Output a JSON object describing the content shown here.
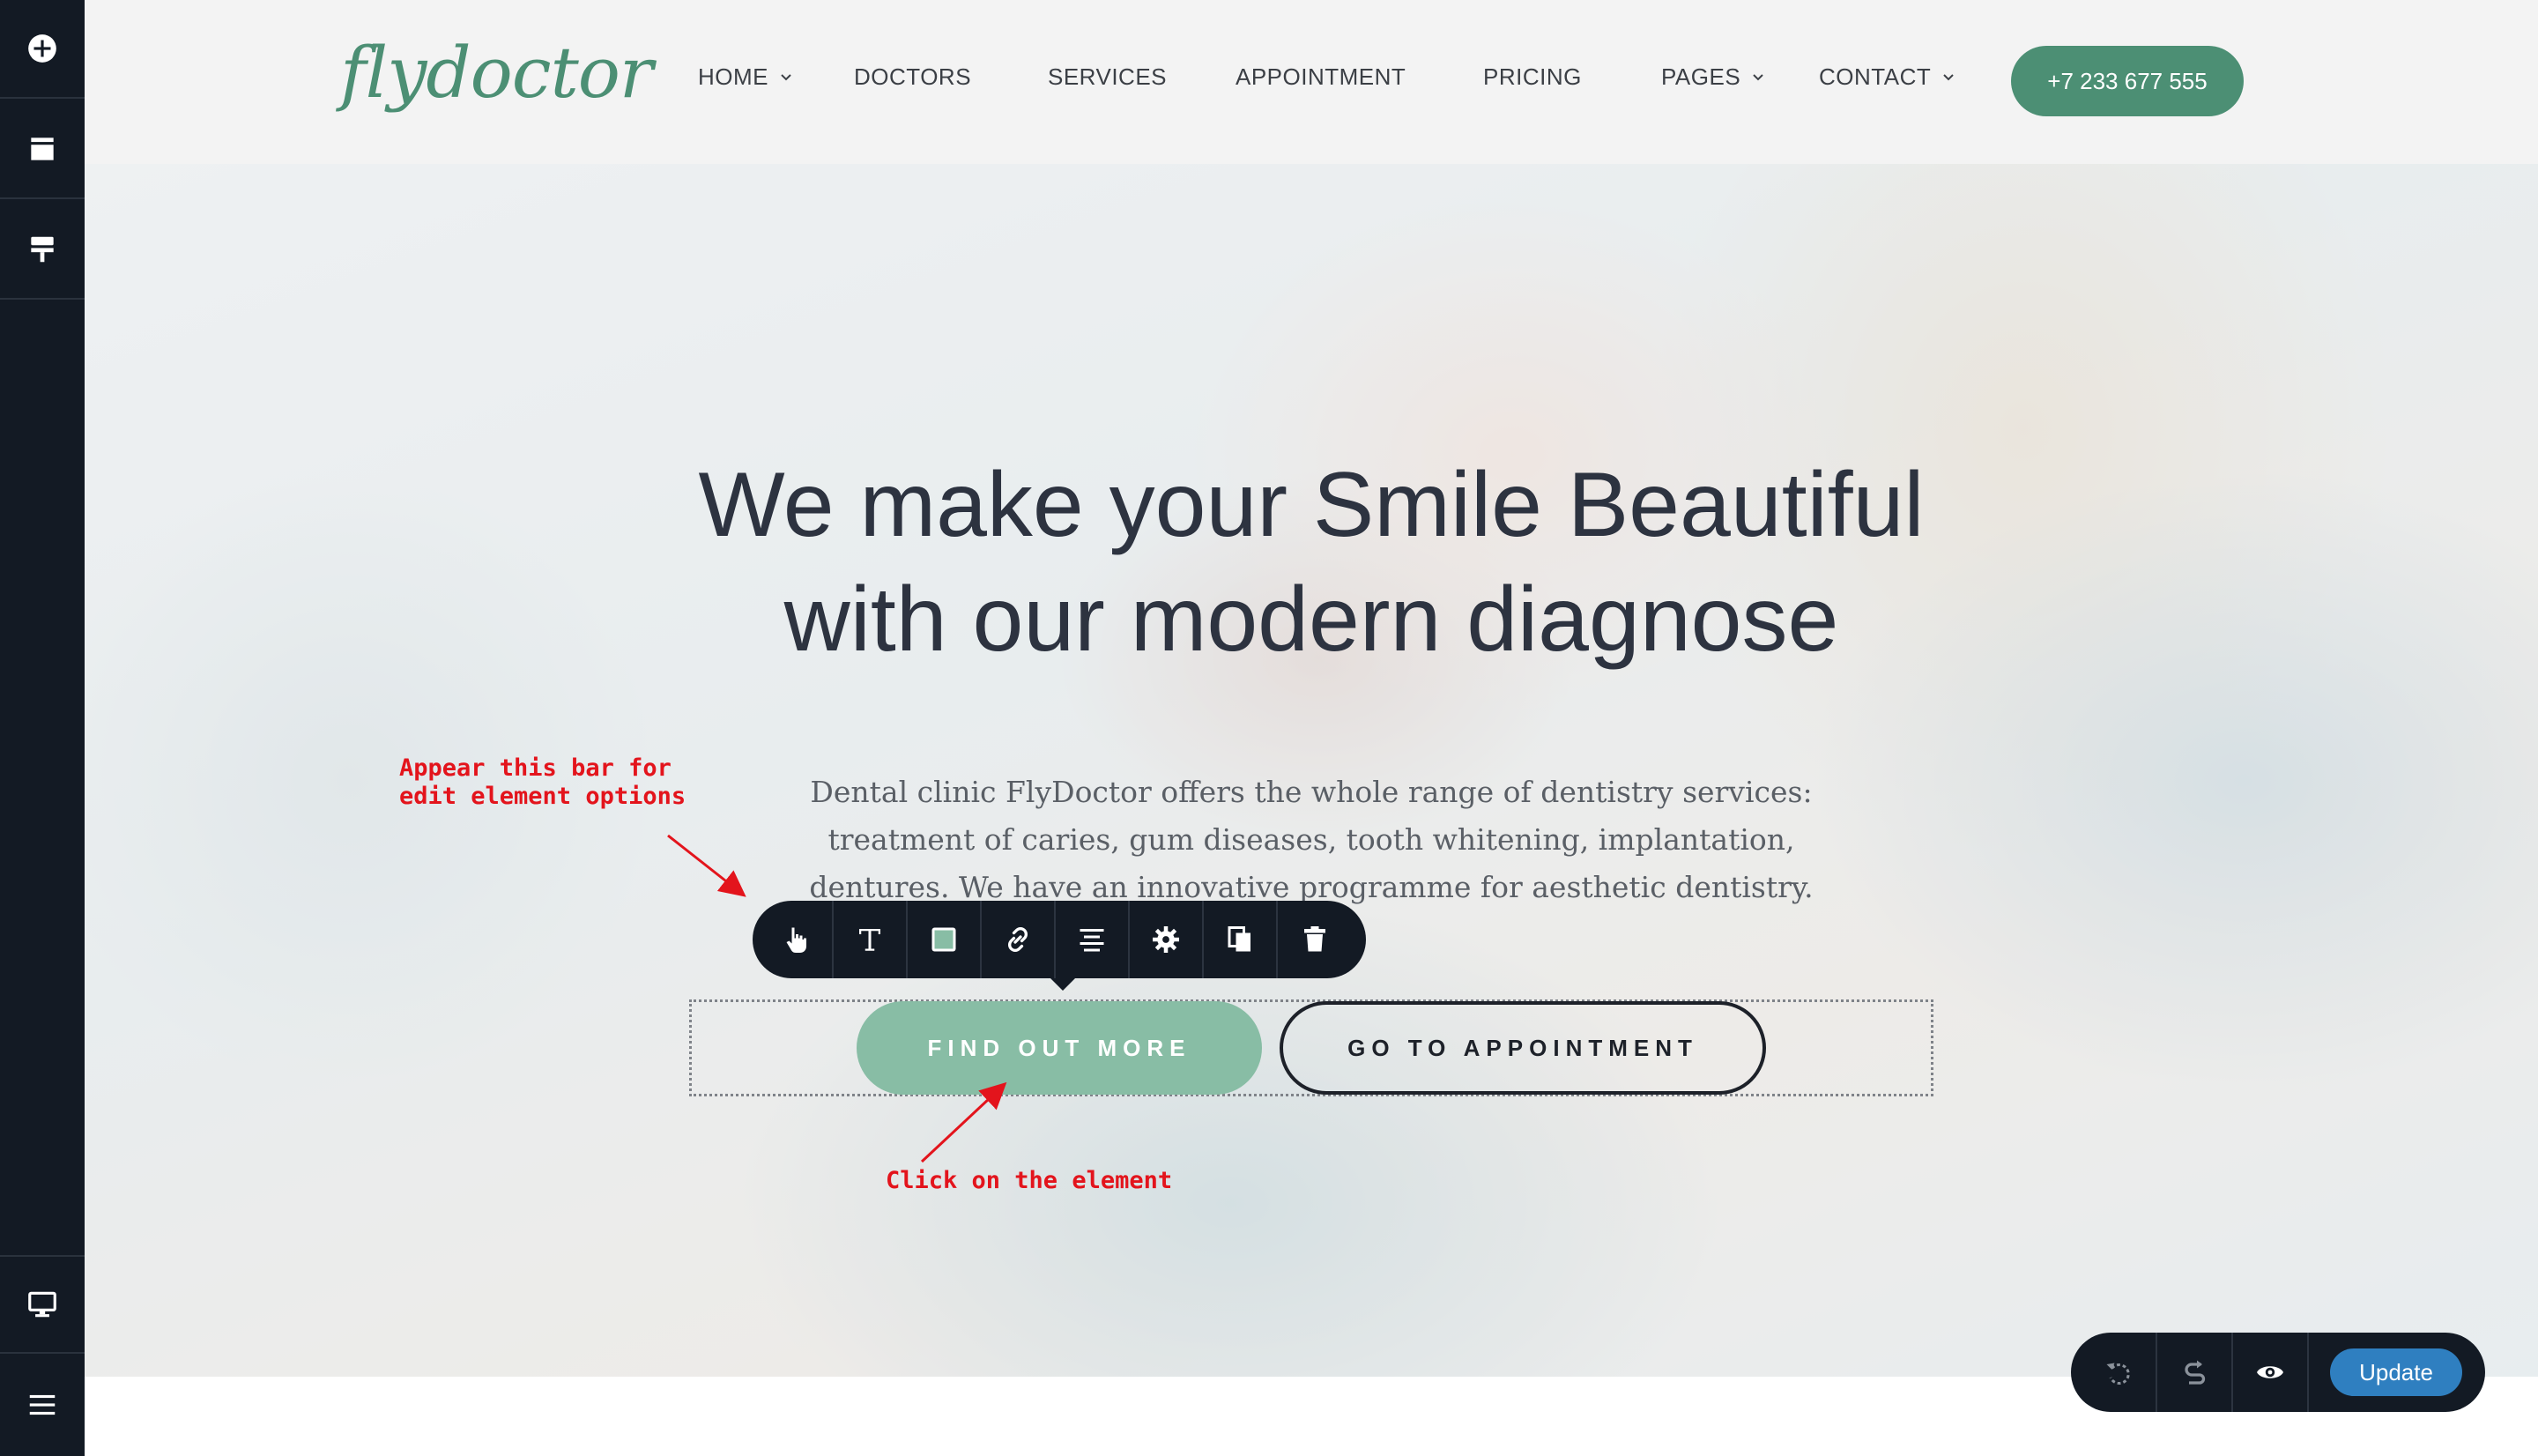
{
  "sidebar": {
    "top_icons": [
      "plus-circle-icon",
      "layout-block-icon",
      "paint-roller-icon"
    ],
    "bottom_icons": [
      "desktop-monitor-icon",
      "hamburger-menu-icon"
    ]
  },
  "header": {
    "logo": "flydoctor",
    "nav": [
      {
        "label": "HOME",
        "has_dropdown": true
      },
      {
        "label": "DOCTORS",
        "has_dropdown": false
      },
      {
        "label": "SERVICES",
        "has_dropdown": false
      },
      {
        "label": "APPOINTMENT",
        "has_dropdown": false
      },
      {
        "label": "PRICING",
        "has_dropdown": false
      },
      {
        "label": "PAGES",
        "has_dropdown": true
      },
      {
        "label": "CONTACT",
        "has_dropdown": true
      }
    ],
    "phone_button": "+7 233 677 555"
  },
  "hero": {
    "title_line1": "We make your Smile Beautiful",
    "title_line2": "with our modern diagnose",
    "text_line1": "Dental clinic FlyDoctor offers the whole range of dentistry services:",
    "text_line2": "treatment of caries, gum diseases, tooth whitening, implantation,",
    "text_line3": "dentures. We have an innovative programme for aesthetic dentistry.",
    "primary_button": "FIND OUT MORE",
    "secondary_button": "GO TO APPOINTMENT"
  },
  "element_toolbar": {
    "icons": [
      "hand-pointer-icon",
      "text-icon",
      "fill-color-icon",
      "link-icon",
      "align-center-icon",
      "settings-gear-icon",
      "duplicate-icon",
      "trash-icon"
    ]
  },
  "annotations": {
    "toolbar_note": "Appear this bar for\nedit element options",
    "click_note": "Click on the element"
  },
  "controls": {
    "icons": [
      "undo-icon",
      "redo-icon",
      "preview-eye-icon"
    ],
    "update_label": "Update"
  },
  "colors": {
    "brand_green": "#4c8f74",
    "light_green": "#88bda5",
    "editor_dark": "#131a24",
    "update_blue": "#2f7fc0",
    "annotation_red": "#e3141c"
  }
}
